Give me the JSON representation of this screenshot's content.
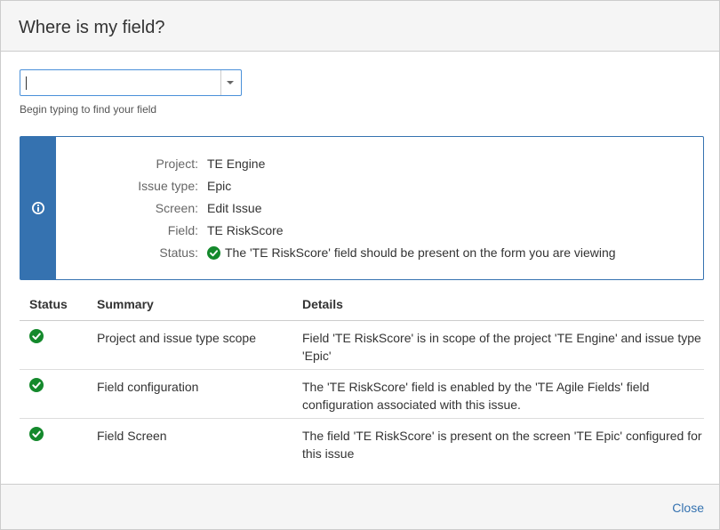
{
  "dialog": {
    "title": "Where is my field?",
    "close_label": "Close"
  },
  "search": {
    "value": "",
    "hint": "Begin typing to find your field"
  },
  "info": {
    "icon": "info-icon",
    "rows": [
      {
        "label": "Project:",
        "value": "TE Engine"
      },
      {
        "label": "Issue type:",
        "value": "Epic"
      },
      {
        "label": "Screen:",
        "value": "Edit Issue"
      },
      {
        "label": "Field:",
        "value": "TE RiskScore"
      },
      {
        "label": "Status:",
        "value": "The 'TE RiskScore' field should be present on the form you are viewing",
        "icon": "check-circle-icon"
      }
    ]
  },
  "table": {
    "headers": [
      "Status",
      "Summary",
      "Details"
    ],
    "rows": [
      {
        "status_icon": "check-circle-icon",
        "summary": "Project and issue type scope",
        "details": "Field 'TE RiskScore' is in scope of the project 'TE Engine' and issue type 'Epic'"
      },
      {
        "status_icon": "check-circle-icon",
        "summary": "Field configuration",
        "details": "The 'TE RiskScore' field is enabled by the 'TE Agile Fields' field configuration associated with this issue."
      },
      {
        "status_icon": "check-circle-icon",
        "summary": "Field Screen",
        "details": "The field 'TE RiskScore' is present on the screen 'TE Epic' configured for this issue"
      }
    ]
  },
  "colors": {
    "accent": "#3572b0",
    "success": "#14892c"
  }
}
